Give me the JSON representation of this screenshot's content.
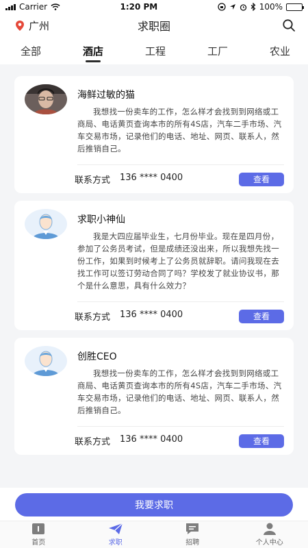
{
  "status_bar": {
    "carrier": "Carrier",
    "time": "1:20 PM",
    "battery": "100%"
  },
  "header": {
    "location": "广州",
    "title": "求职圈"
  },
  "tabs": [
    {
      "label": "全部",
      "active": false
    },
    {
      "label": "酒店",
      "active": true
    },
    {
      "label": "工程",
      "active": false
    },
    {
      "label": "工厂",
      "active": false
    },
    {
      "label": "农业",
      "active": false
    }
  ],
  "posts": [
    {
      "name": "海鲜过敏的猫",
      "avatar": "photo-avatar",
      "content": "我想找一份卖车的工作，怎么样才会找到到网络或工商局、电话黄页查询本市的所有4S店，汽车二手市场、汽车交易市场，记录他们的电话、地址、网页、联系人，然后推销自己。",
      "contact_label": "联系方式",
      "phone": "136 **** 0400",
      "button": "查看"
    },
    {
      "name": "求职小神仙",
      "avatar": "default-avatar",
      "content": "我是大四应届毕业生，七月份毕业。现在是四月份，参加了公务员考试，但是成绩还没出来，所以我想先找一份工作，如果到时候考上了公务员就辞职。请问我现在去找工作可以签订劳动合同了吗？学校发了就业协议书，那个是什么意思，具有什么效力？",
      "contact_label": "联系方式",
      "phone": "136 **** 0400",
      "button": "查看"
    },
    {
      "name": "创胜CEO",
      "avatar": "default-avatar",
      "content": "我想找一份卖车的工作，怎么样才会找到到网络或工商局、电话黄页查询本市的所有4S店，汽车二手市场、汽车交易市场，记录他们的电话、地址、网页、联系人，然后推销自己。",
      "contact_label": "联系方式",
      "phone": "136 **** 0400",
      "button": "查看"
    }
  ],
  "apply_button": "我要求职",
  "tabbar": [
    {
      "label": "首页",
      "icon": "home-icon",
      "active": false
    },
    {
      "label": "求职",
      "icon": "paper-plane-icon",
      "active": true
    },
    {
      "label": "招聘",
      "icon": "chat-icon",
      "active": false
    },
    {
      "label": "个人中心",
      "icon": "person-icon",
      "active": false
    }
  ],
  "colors": {
    "accent": "#5c6be6",
    "background": "#f4f5f7",
    "card": "#ffffff"
  }
}
